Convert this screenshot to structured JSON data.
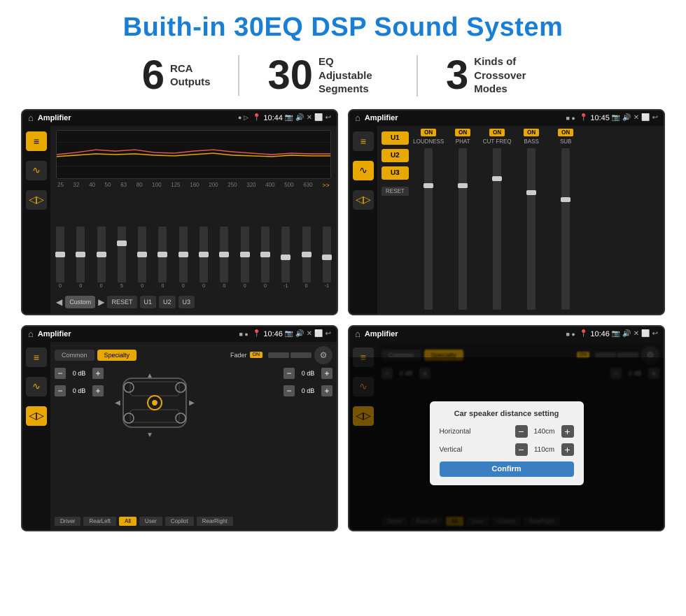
{
  "title": "Buith-in 30EQ DSP Sound System",
  "stats": [
    {
      "number": "6",
      "label": "RCA\nOutputs"
    },
    {
      "number": "30",
      "label": "EQ Adjustable\nSegments"
    },
    {
      "number": "3",
      "label": "Kinds of\nCrossover Modes"
    }
  ],
  "screen1": {
    "appName": "Amplifier",
    "time": "10:44",
    "eqBands": [
      "25",
      "32",
      "40",
      "50",
      "63",
      "80",
      "100",
      "125",
      "160",
      "200",
      "250",
      "320",
      "400",
      "500",
      "630"
    ],
    "eqValues": [
      "0",
      "0",
      "0",
      "5",
      "0",
      "0",
      "0",
      "0",
      "0",
      "0",
      "0",
      "-1",
      "0",
      "-1"
    ],
    "bottomButtons": [
      "Custom",
      "RESET",
      "U1",
      "U2",
      "U3"
    ]
  },
  "screen2": {
    "appName": "Amplifier",
    "time": "10:45",
    "uButtons": [
      "U1",
      "U2",
      "U3"
    ],
    "channels": [
      {
        "on": true,
        "label": "LOUDNESS"
      },
      {
        "on": true,
        "label": "PHAT"
      },
      {
        "on": true,
        "label": "CUT FREQ"
      },
      {
        "on": true,
        "label": "BASS"
      },
      {
        "on": true,
        "label": "SUB"
      }
    ],
    "resetLabel": "RESET"
  },
  "screen3": {
    "appName": "Amplifier",
    "time": "10:46",
    "tabs": [
      "Common",
      "Specialty"
    ],
    "faderLabel": "Fader",
    "onLabel": "ON",
    "dbValues": [
      "0 dB",
      "0 dB",
      "0 dB",
      "0 dB"
    ],
    "bottomBtns": [
      "Driver",
      "RearLeft",
      "All",
      "User",
      "Copilot",
      "RearRight"
    ]
  },
  "screen4": {
    "appName": "Amplifier",
    "time": "10:46",
    "tabs": [
      "Common",
      "Specialty"
    ],
    "onLabel": "ON",
    "dialog": {
      "title": "Car speaker distance setting",
      "rows": [
        {
          "label": "Horizontal",
          "value": "140cm"
        },
        {
          "label": "Vertical",
          "value": "110cm"
        }
      ],
      "confirmLabel": "Confirm"
    },
    "dbValues": [
      "0 dB",
      "0 dB"
    ],
    "bottomBtns": [
      "Driver",
      "RearLeft",
      "All",
      "User",
      "Copilot",
      "RearRight"
    ]
  }
}
